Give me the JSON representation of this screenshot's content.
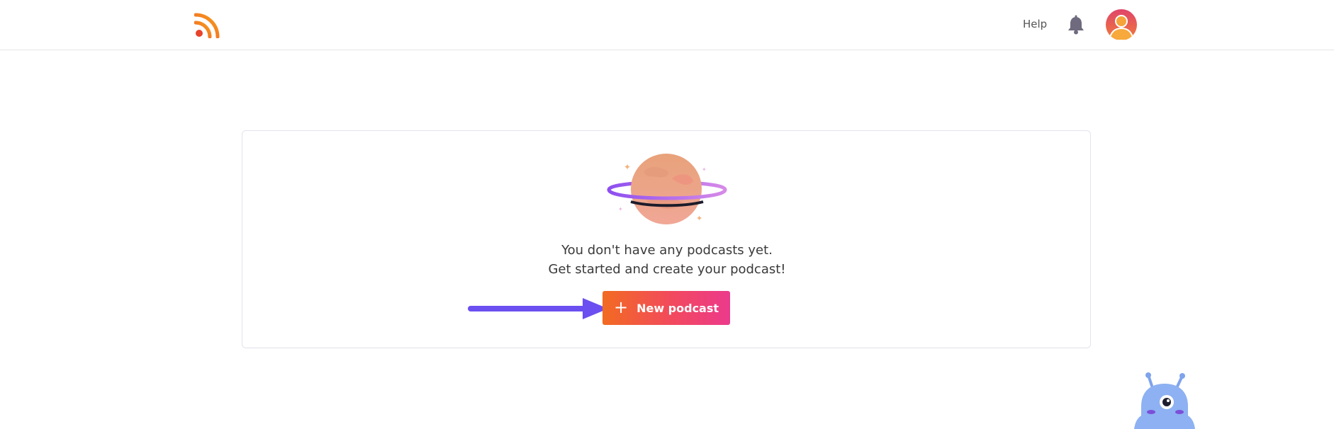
{
  "header": {
    "logo_icon": "rss-feed-icon",
    "help_label": "Help",
    "bell_icon": "bell-icon",
    "avatar_icon": "user-avatar-icon"
  },
  "empty_state": {
    "illustration": "planet-illustration",
    "line1": "You don't have any podcasts yet.",
    "line2": "Get started and create your podcast!",
    "button": {
      "icon": "plus-icon",
      "label": "New podcast"
    },
    "annotation_arrow": "arrow-pointer-icon"
  },
  "chat_widget": {
    "icon": "alien-mascot-icon"
  },
  "colors": {
    "brand_orange": "#f26b21",
    "brand_pink": "#ec3a8c",
    "arrow_purple": "#6b4ff0",
    "text": "#3a3a3a"
  }
}
